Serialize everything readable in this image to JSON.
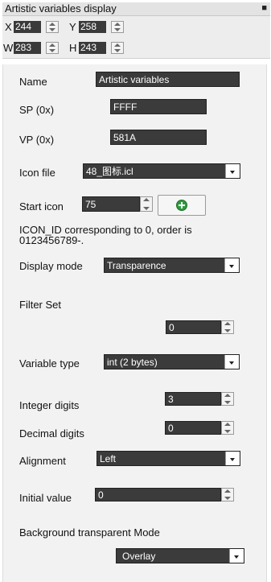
{
  "titlebar": {
    "title": "Artistic variables display",
    "pin_glyph": "■"
  },
  "geometry_fields": {
    "x_label": "X",
    "x_value": "244",
    "y_label": "Y",
    "y_value": "258",
    "w_label": "W",
    "w_value": "283",
    "h_label": "H",
    "h_value": "243"
  },
  "properties": {
    "name_label": "Name",
    "name_value": "Artistic variables",
    "sp_label": "SP (0x)",
    "sp_value": "FFFF",
    "vp_label": "VP (0x)",
    "vp_value": "581A",
    "icon_file_label": "Icon file",
    "icon_file_value": "48_图标.icl",
    "start_icon_label": "Start icon",
    "start_icon_value": "75",
    "icon_note": "ICON_ID corresponding to 0, order is 0123456789-.",
    "display_mode_label": "Display mode",
    "display_mode_value": "Transparence",
    "filter_set_label": "Filter Set",
    "filter_set_value": "0",
    "variable_type_label": "Variable type",
    "variable_type_value": "int (2 bytes)",
    "integer_digits_label": "Integer digits",
    "integer_digits_value": "3",
    "decimal_digits_label": "Decimal digits",
    "decimal_digits_value": "0",
    "alignment_label": "Alignment",
    "alignment_value": "Left",
    "initial_value_label": "Initial value",
    "initial_value_value": "0",
    "background_mode_label": "Background transparent Mode",
    "background_mode_value": "Overlay"
  },
  "icons": {
    "add_button_icon": "plus-circle-icon",
    "accent": "#2e9b3d"
  }
}
